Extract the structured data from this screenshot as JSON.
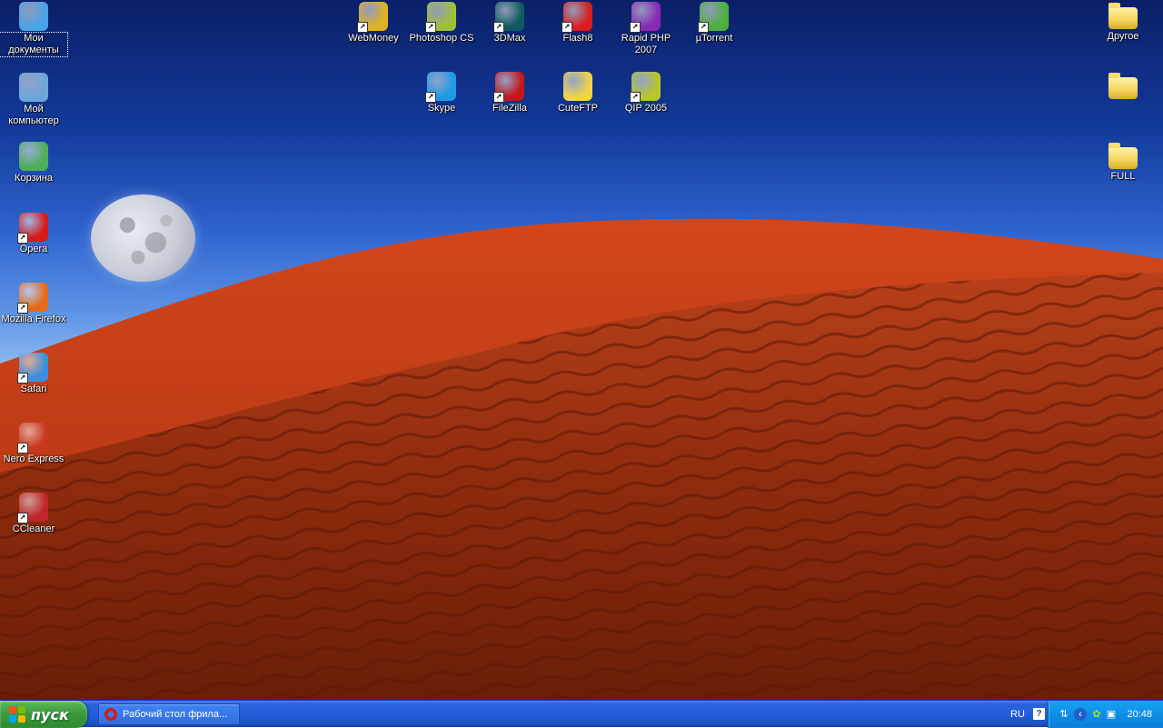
{
  "desktop": {
    "left_icons": [
      {
        "label": "Мои документы",
        "icon": "my-documents-icon",
        "color": "#4aa3e6"
      },
      {
        "label": "Мой компьютер",
        "icon": "my-computer-icon",
        "color": "#6ea6d8"
      },
      {
        "label": "Корзина",
        "icon": "recycle-bin-icon",
        "color": "#4fae5a"
      },
      {
        "label": "Opera",
        "icon": "opera-icon",
        "color": "#d41c1c"
      },
      {
        "label": "Mozilla Firefox",
        "icon": "firefox-icon",
        "color": "#e56a1c"
      },
      {
        "label": "Safari",
        "icon": "safari-icon",
        "color": "#3b8fdc"
      },
      {
        "label": "Nero Express",
        "icon": "nero-express-icon",
        "color": "#c9381f"
      },
      {
        "label": "CCleaner",
        "icon": "ccleaner-icon",
        "color": "#c0262b"
      }
    ],
    "top_icons_row1": [
      {
        "label": "WebMoney",
        "icon": "webmoney-icon",
        "color": "#e0b21f"
      },
      {
        "label": "Photoshop CS",
        "icon": "photoshop-icon",
        "color": "#9fbf3a"
      },
      {
        "label": "3DMax",
        "icon": "3dmax-icon",
        "color": "#0e5b5e"
      },
      {
        "label": "Flash8",
        "icon": "flash-icon",
        "color": "#d81e1e"
      },
      {
        "label": "Rapid PHP 2007",
        "icon": "rapid-php-icon",
        "color": "#8a2ab4"
      },
      {
        "label": "µTorrent",
        "icon": "utorrent-icon",
        "color": "#4caf3e"
      }
    ],
    "top_icons_row2": [
      {
        "label": "Skype",
        "icon": "skype-icon",
        "color": "#1f9be6"
      },
      {
        "label": "FileZilla",
        "icon": "filezilla-icon",
        "color": "#c3171b"
      },
      {
        "label": "CuteFTP",
        "icon": "cuteftp-icon",
        "color": "#f0d44a"
      },
      {
        "label": "QIP 2005",
        "icon": "qip-icon",
        "color": "#b6c62b"
      }
    ],
    "right_icons": [
      {
        "label": "Другое",
        "icon": "folder-icon"
      },
      {
        "label": "",
        "icon": "folder-icon"
      },
      {
        "label": "FULL",
        "icon": "folder-icon"
      }
    ]
  },
  "taskbar": {
    "start_label": "пуск",
    "task_item": "Рабочий стол фрила...",
    "language": "RU",
    "clock": "20:48"
  },
  "colors": {
    "taskbar": "#245edb",
    "start_button": "#3c9b3c",
    "tray": "#0f8ee6"
  }
}
